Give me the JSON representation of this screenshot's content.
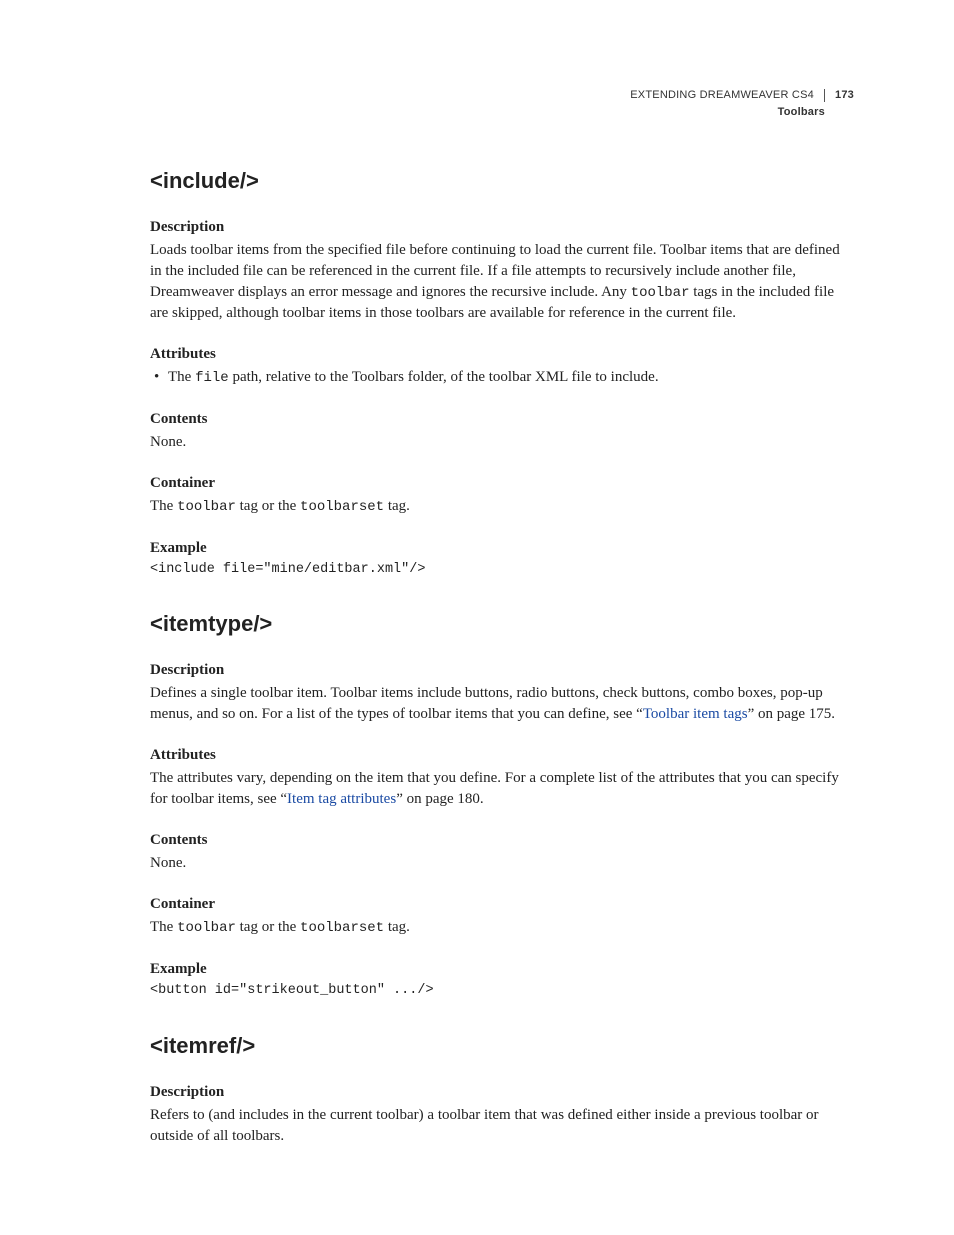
{
  "header": {
    "book_title": "EXTENDING DREAMWEAVER CS4",
    "page_number": "173",
    "section": "Toolbars"
  },
  "entries": [
    {
      "title": "<include/>",
      "desc_head": "Description",
      "desc_parts": [
        "Loads toolbar items from the specified file before continuing to load the current file. Toolbar items that are defined in the included file can be referenced in the current file. If a file attempts to recursively include another file, Dreamweaver displays an error message and ignores the recursive include. Any ",
        "toolbar",
        " tags in the included file are skipped, although toolbar items in those toolbars are available for reference in the current file."
      ],
      "attr_head": "Attributes",
      "attr_bullet": {
        "pre": "The ",
        "code": "file",
        "post": " path, relative to the Toolbars folder, of the toolbar XML file to include."
      },
      "contents_head": "Contents",
      "contents_body": "None.",
      "container_head": "Container",
      "container_parts": [
        "The ",
        "toolbar",
        " tag or the ",
        "toolbarset",
        " tag."
      ],
      "example_head": "Example",
      "example_code": "<include file=\"mine/editbar.xml\"/>"
    },
    {
      "title": "<itemtype/>",
      "desc_head": "Description",
      "desc_parts": [
        "Defines a single toolbar item. Toolbar items include buttons, radio buttons, check buttons, combo boxes, pop-up menus, and so on. For a list of the types of toolbar items that you can define, see “"
      ],
      "desc_link": "Toolbar item tags",
      "desc_post_link": "” on page 175.",
      "attr_head": "Attributes",
      "attr_text_pre": "The attributes vary, depending on the item that you define. For a complete list of the attributes that you can specify for toolbar items, see “",
      "attr_link": "Item tag attributes",
      "attr_text_post": "” on page 180.",
      "contents_head": "Contents",
      "contents_body": "None.",
      "container_head": "Container",
      "container_parts": [
        "The ",
        "toolbar",
        " tag or the ",
        "toolbarset",
        " tag."
      ],
      "example_head": "Example",
      "example_code": "<button id=\"strikeout_button\" .../>"
    },
    {
      "title": "<itemref/>",
      "desc_head": "Description",
      "desc_parts": [
        "Refers to (and includes in the current toolbar) a toolbar item that was defined either inside a previous toolbar or outside of all toolbars."
      ]
    }
  ]
}
